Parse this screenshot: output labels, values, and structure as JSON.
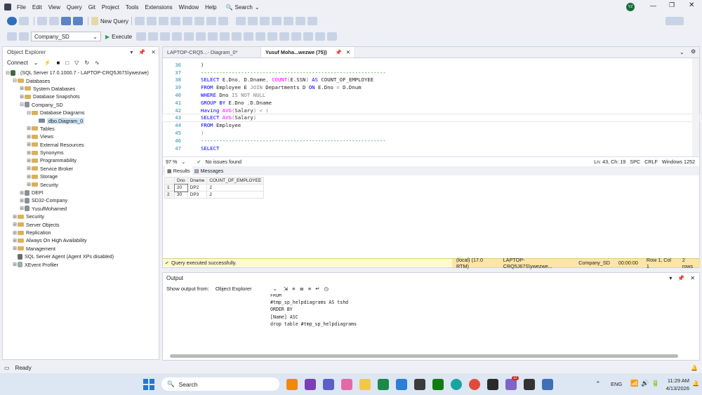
{
  "menu": [
    "File",
    "Edit",
    "View",
    "Query",
    "Git",
    "Project",
    "Tools",
    "Extensions",
    "Window",
    "Help"
  ],
  "search_label": "Search",
  "avatar_initials": "YZ",
  "toolbar1": {
    "new_query": "New Query"
  },
  "toolbar2": {
    "database": "Company_SD",
    "execute": "Execute"
  },
  "object_explorer": {
    "title": "Object Explorer",
    "connect": "Connect",
    "tree": [
      {
        "indent": 0,
        "exp": "⊟",
        "icon": "server",
        "label": ". (SQL Server 17.0.1000.7 - LAPTOP-CRQ5J67S\\ywezwe)"
      },
      {
        "indent": 1,
        "exp": "⊟",
        "icon": "folder",
        "label": "Databases"
      },
      {
        "indent": 2,
        "exp": "⊞",
        "icon": "folder",
        "label": "System Databases"
      },
      {
        "indent": 2,
        "exp": "⊞",
        "icon": "folder",
        "label": "Database Snapshots"
      },
      {
        "indent": 2,
        "exp": "⊟",
        "icon": "db",
        "label": "Company_SD"
      },
      {
        "indent": 3,
        "exp": "⊟",
        "icon": "folder",
        "label": "Database Diagrams"
      },
      {
        "indent": 4,
        "exp": "",
        "icon": "diagram",
        "label": "dbo.Diagram_0"
      },
      {
        "indent": 3,
        "exp": "⊞",
        "icon": "folder",
        "label": "Tables"
      },
      {
        "indent": 3,
        "exp": "⊞",
        "icon": "folder",
        "label": "Views"
      },
      {
        "indent": 3,
        "exp": "⊞",
        "icon": "folder",
        "label": "External Resources"
      },
      {
        "indent": 3,
        "exp": "⊞",
        "icon": "folder",
        "label": "Synonyms"
      },
      {
        "indent": 3,
        "exp": "⊞",
        "icon": "folder",
        "label": "Programmability"
      },
      {
        "indent": 3,
        "exp": "⊞",
        "icon": "folder",
        "label": "Service Broker"
      },
      {
        "indent": 3,
        "exp": "⊞",
        "icon": "folder",
        "label": "Storage"
      },
      {
        "indent": 3,
        "exp": "⊞",
        "icon": "folder",
        "label": "Security"
      },
      {
        "indent": 2,
        "exp": "⊞",
        "icon": "db",
        "label": "DEPI"
      },
      {
        "indent": 2,
        "exp": "⊞",
        "icon": "db",
        "label": "SD32-Company"
      },
      {
        "indent": 2,
        "exp": "⊞",
        "icon": "db",
        "label": "YusufMohamed"
      },
      {
        "indent": 1,
        "exp": "⊞",
        "icon": "folder",
        "label": "Security"
      },
      {
        "indent": 1,
        "exp": "⊞",
        "icon": "folder",
        "label": "Server Objects"
      },
      {
        "indent": 1,
        "exp": "⊞",
        "icon": "folder",
        "label": "Replication"
      },
      {
        "indent": 1,
        "exp": "⊞",
        "icon": "folder",
        "label": "Always On High Availability"
      },
      {
        "indent": 1,
        "exp": "⊞",
        "icon": "folder",
        "label": "Management"
      },
      {
        "indent": 1,
        "exp": "",
        "icon": "agent",
        "label": "SQL Server Agent (Agent XPs disabled)"
      },
      {
        "indent": 1,
        "exp": "⊞",
        "icon": "xevent",
        "label": "XEvent Profiler"
      }
    ]
  },
  "tabs": [
    {
      "label": "LAPTOP-CRQ5...- Diagram_0*",
      "active": false
    },
    {
      "label": "Yusuf Moha...wezwe (75))",
      "active": true
    }
  ],
  "code_lines": [
    {
      "n": "36",
      "html": ")"
    },
    {
      "n": "37",
      "html": "<span class='grn'>------------------------------------------------------------</span>"
    },
    {
      "n": "38",
      "html": "<span class='kw'>SELECT</span> E.Dno<span class='gray'>,</span> D.Dname<span class='gray'>,</span> <span class='fn'>COUNT</span><span class='gray'>(</span>E.SSN<span class='gray'>)</span> <span class='kw'>AS</span> COUNT_OF_EMPLOYEE"
    },
    {
      "n": "39",
      "html": "<span class='kw'>FROM</span> Employee E <span class='gray'>JOIN</span> Departments D <span class='kw'>ON</span> E.Dno <span class='gray'>=</span> D.Dnum"
    },
    {
      "n": "40",
      "html": "<span class='kw'>WHERE</span> Dno <span class='gray'>IS NOT NULL</span>"
    },
    {
      "n": "41",
      "html": "<span class='kw'>GROUP BY</span> E.Dno <span class='gray'>,</span>D.Dname"
    },
    {
      "n": "42",
      "html": "<span class='kw'>Having</span> <span class='fn'>AVG</span><span class='gray'>(</span>Salary<span class='gray'>)</span> <span class='gray'>&lt;</span> <span class='gray'>(</span>"
    },
    {
      "n": "43",
      "html": "<span class='kw'>SELECT</span> <span class='fn'>AVG</span><span class='gray'>(</span>Salary<span class='gray'>)</span>"
    },
    {
      "n": "44",
      "html": "<span class='kw'>FROM</span> Employee"
    },
    {
      "n": "45",
      "html": "<span class='gray'>)</span>"
    },
    {
      "n": "46",
      "html": "<span class='grn'>------------------------------------------------------------</span>"
    },
    {
      "n": "47",
      "html": "<span class='kw'>SELECT</span>"
    }
  ],
  "editor_status": {
    "zoom": "97 %",
    "issues": "No issues found",
    "pos": "Ln: 43, Ch: 19",
    "spc": "SPC",
    "crlf": "CRLF",
    "enc": "Windows 1252"
  },
  "results_tabs": {
    "results": "Results",
    "messages": "Messages"
  },
  "results": {
    "columns": [
      "Dno",
      "Dname",
      "COUNT_OF_EMPLOYEE"
    ],
    "rows": [
      [
        "1",
        "20",
        "DP2",
        "2"
      ],
      [
        "2",
        "30",
        "DP3",
        "2"
      ]
    ]
  },
  "query_status": {
    "message": "Query executed successfully.",
    "server": "(local) (17.0 RTM)",
    "login": "LAPTOP-CRQ5J67S\\ywezwe...",
    "db": "Company_SD",
    "time": "00:00:00",
    "rowcol": "Row 1, Col 1",
    "rows": "2 rows"
  },
  "output": {
    "title": "Output",
    "show_from_label": "Show output from:",
    "source": "Object Explorer",
    "lines": [
      "FROM",
      "#tmp_sp_helpdiagrams AS tshd",
      "ORDER BY",
      "[Name] ASC",
      "drop table #tmp_sp_helpdiagrams"
    ]
  },
  "statusbar": {
    "ready": "Ready"
  },
  "taskbar": {
    "search": "Search",
    "lang": "ENG",
    "time": "11:29 AM",
    "date": "4/13/2026",
    "badge": "12",
    "notify": "1"
  }
}
